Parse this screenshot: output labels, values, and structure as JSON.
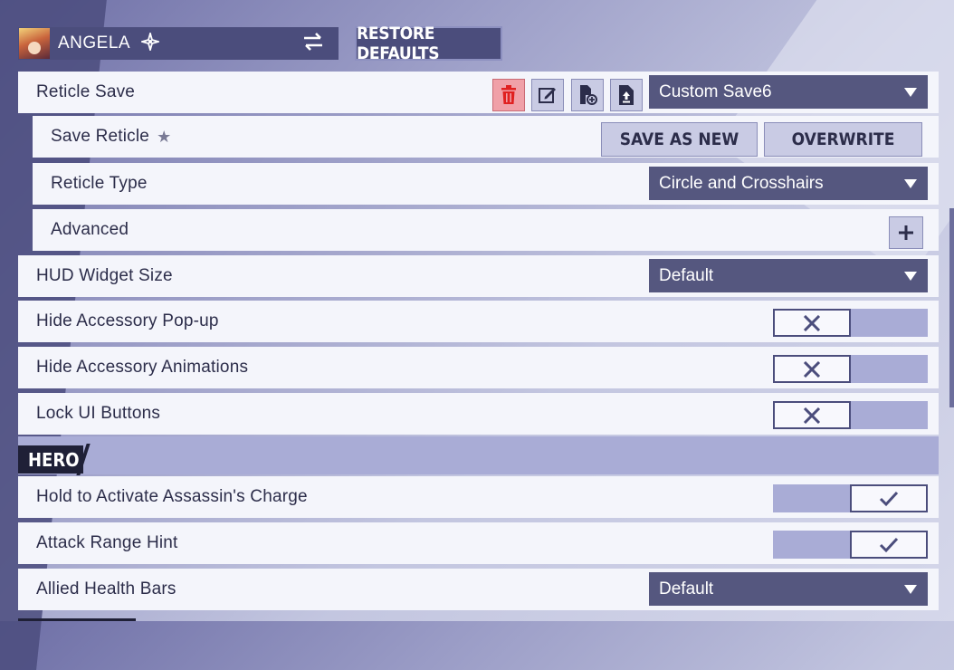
{
  "header": {
    "hero_name": "ANGELA",
    "role_icon": "sparkle-icon",
    "swap_icon": "swap-arrows-icon",
    "restore_label": "RESTORE DEFAULTS"
  },
  "rows": {
    "reticle_save": {
      "label": "Reticle Save",
      "selected": "Custom Save6"
    },
    "save_reticle": {
      "label": "Save Reticle",
      "save_as_new": "SAVE AS NEW",
      "overwrite": "OVERWRITE"
    },
    "reticle_type": {
      "label": "Reticle Type",
      "selected": "Circle and Crosshairs"
    },
    "advanced": {
      "label": "Advanced"
    },
    "hud_widget_size": {
      "label": "HUD Widget Size",
      "selected": "Default"
    },
    "hide_accessory_popup": {
      "label": "Hide Accessory Pop-up",
      "enabled": false
    },
    "hide_accessory_animations": {
      "label": "Hide Accessory Animations",
      "enabled": false
    },
    "lock_ui_buttons": {
      "label": "Lock UI Buttons",
      "enabled": false
    }
  },
  "hero_section": {
    "title": "HERO",
    "hold_to_activate": {
      "label": "Hold to Activate Assassin's Charge",
      "enabled": true
    },
    "attack_range_hint": {
      "label": "Attack Range Hint",
      "enabled": true
    },
    "allied_health_bars": {
      "label": "Allied Health Bars",
      "selected": "Default"
    }
  },
  "colors": {
    "panel_dark": "#4b4d7c",
    "dropdown": "#55577f",
    "row_bg": "#f4f5fb",
    "toggle_track": "#a9acd6",
    "delete_red": "#e02020"
  }
}
